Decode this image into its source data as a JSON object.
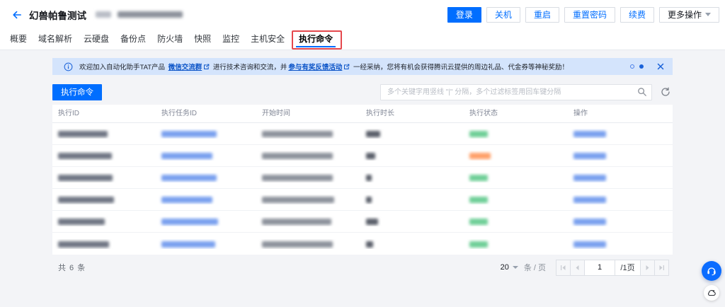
{
  "header": {
    "title": "幻兽帕鲁测试",
    "redacted": [
      {
        "w": 22,
        "c": "#b9bdc6"
      },
      {
        "w": 92,
        "c": "#8d929c"
      }
    ],
    "actions": [
      {
        "id": "login",
        "label": "登录",
        "type": "primary",
        "caret": false
      },
      {
        "id": "shutdown",
        "label": "关机",
        "type": "default",
        "caret": false
      },
      {
        "id": "restart",
        "label": "重启",
        "type": "default",
        "caret": false
      },
      {
        "id": "reset-password",
        "label": "重置密码",
        "type": "default",
        "caret": false
      },
      {
        "id": "renew",
        "label": "续费",
        "type": "default",
        "caret": false
      },
      {
        "id": "more-actions",
        "label": "更多操作",
        "type": "more",
        "caret": true
      }
    ]
  },
  "tabs": {
    "active_index": 8,
    "items": [
      {
        "id": "overview",
        "label": "概要"
      },
      {
        "id": "dns",
        "label": "域名解析"
      },
      {
        "id": "cloud-disk",
        "label": "云硬盘"
      },
      {
        "id": "backup-point",
        "label": "备份点"
      },
      {
        "id": "firewall",
        "label": "防火墙"
      },
      {
        "id": "snapshot",
        "label": "快照"
      },
      {
        "id": "monitor",
        "label": "监控"
      },
      {
        "id": "host-security",
        "label": "主机安全"
      },
      {
        "id": "execute-command",
        "label": "执行命令"
      }
    ]
  },
  "annotation": {
    "type": "highlight-box",
    "color": "#e5484d",
    "target": "execute-command-tab"
  },
  "banner": {
    "icon": "info-circle-icon",
    "parts": [
      {
        "t": "欢迎加入自动化助手TAT产品 ",
        "link": false,
        "ext": false
      },
      {
        "t": "微信交流群",
        "link": true,
        "ext": true
      },
      {
        "t": " 进行技术咨询和交流，并",
        "link": false,
        "ext": false
      },
      {
        "t": "参与有奖反馈活动",
        "link": true,
        "ext": true
      },
      {
        "t": " 一经采纳，您将有机会获得腾讯云提供的周边礼品、代金券等神秘奖励！",
        "link": false,
        "ext": false
      }
    ],
    "pager_dots": 2,
    "active_dot": 1
  },
  "toolbar": {
    "execute_button": "执行命令",
    "search_placeholder": "多个关键字用竖线 \"|\" 分隔，多个过滤标签用回车键分隔"
  },
  "table": {
    "columns": [
      "执行ID",
      "执行任务ID",
      "开始时间",
      "执行时长",
      "执行状态",
      "操作"
    ],
    "rows": [
      {
        "id_w": 70,
        "task_w": 78,
        "time_w": 100,
        "dur_w": 20,
        "status": "success",
        "action_w": 46
      },
      {
        "id_w": 76,
        "task_w": 72,
        "time_w": 100,
        "dur_w": 13,
        "status": "failed",
        "action_w": 46
      },
      {
        "id_w": 77,
        "task_w": 78,
        "time_w": 100,
        "dur_w": 8,
        "status": "success",
        "action_w": 46
      },
      {
        "id_w": 79,
        "task_w": 72,
        "time_w": 102,
        "dur_w": 8,
        "status": "success",
        "action_w": 46
      },
      {
        "id_w": 66,
        "task_w": 80,
        "time_w": 98,
        "dur_w": 17,
        "status": "success",
        "action_w": 46
      },
      {
        "id_w": 72,
        "task_w": 76,
        "time_w": 100,
        "dur_w": 10,
        "status": "success",
        "action_w": 46
      }
    ]
  },
  "footer": {
    "total": "共 6 条",
    "page_size": "20",
    "unit": "条 / 页",
    "page": "1",
    "page_suffix": "/1页"
  },
  "colors": {
    "accent": "#006eff",
    "banner_bg": "#d4e4fc",
    "banner_link": "#0a53c7",
    "success": "#6fcf97",
    "failed": "#ffa069",
    "link_blur": "#79a0ef",
    "id_blur": "#707684",
    "time_blur": "#8d929c",
    "dur_blur": "#5a5f6a",
    "annotation": "#e5484d",
    "page_bg": "#f3f4f7"
  }
}
